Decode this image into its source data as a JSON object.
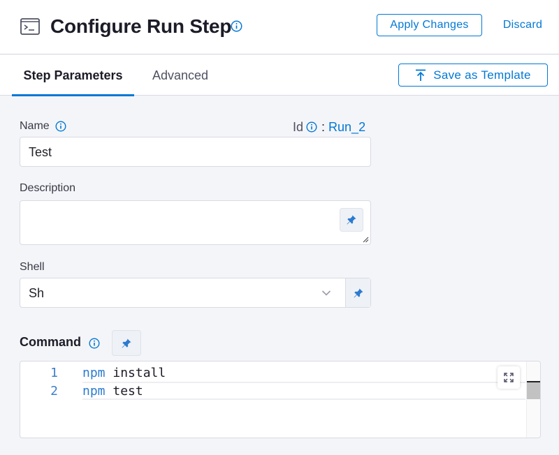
{
  "header": {
    "title": "Configure Run Step",
    "apply_label": "Apply Changes",
    "discard_label": "Discard",
    "step_icon": "terminal-icon"
  },
  "tabs": [
    {
      "label": "Step Parameters",
      "active": true
    },
    {
      "label": "Advanced",
      "active": false
    }
  ],
  "save_template_label": "Save as Template",
  "form": {
    "name": {
      "label": "Name",
      "value": "Test"
    },
    "id": {
      "label": "Id",
      "separator": ":",
      "value": "Run_2"
    },
    "description": {
      "label": "Description",
      "value": ""
    },
    "shell": {
      "label": "Shell",
      "value": "Sh"
    },
    "command": {
      "label": "Command",
      "lines": [
        {
          "num": "1",
          "keyword": "npm",
          "rest": " install"
        },
        {
          "num": "2",
          "keyword": "npm",
          "rest": " test"
        }
      ]
    }
  },
  "colors": {
    "accent": "#0278d5",
    "page_bg": "#f4f5f8",
    "border": "#d9dae5"
  }
}
